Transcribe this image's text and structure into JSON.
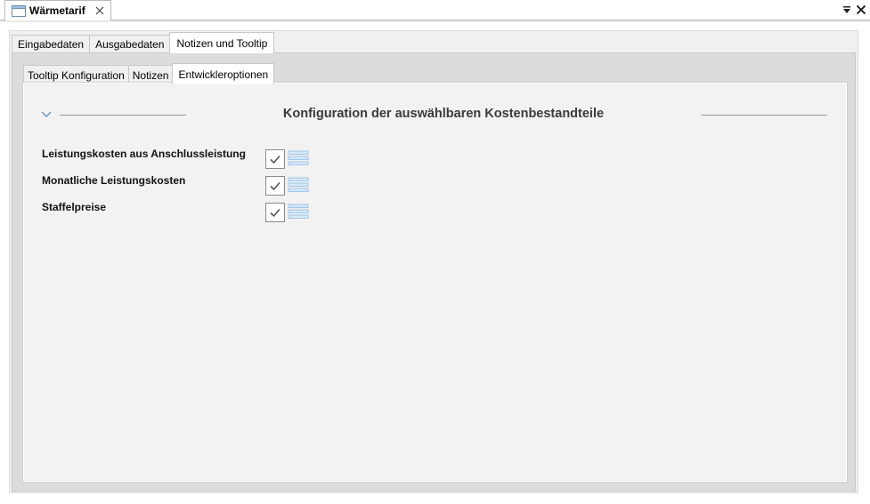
{
  "editor_tab": {
    "title": "Wärmetarif",
    "icon": "window-icon"
  },
  "outer_tabs": [
    {
      "label": "Eingabedaten"
    },
    {
      "label": "Ausgabedaten"
    },
    {
      "label": "Notizen und Tooltip",
      "active": true
    }
  ],
  "inner_tabs": [
    {
      "label": "Tooltip Konfiguration"
    },
    {
      "label": "Notizen"
    },
    {
      "label": "Entwickleroptionen",
      "active": true
    }
  ],
  "section": {
    "title": "Konfiguration der auswählbaren Kostenbestandteile",
    "icon": "chevron-down-icon"
  },
  "options": [
    {
      "label": "Leistungskosten aus Anschlussleistung",
      "checked": true
    },
    {
      "label": "Monatliche Leistungskosten",
      "checked": true
    },
    {
      "label": "Staffelpreise",
      "checked": true
    }
  ],
  "colors": {
    "accent_list": "#9fc6e8",
    "check": "#555555"
  }
}
